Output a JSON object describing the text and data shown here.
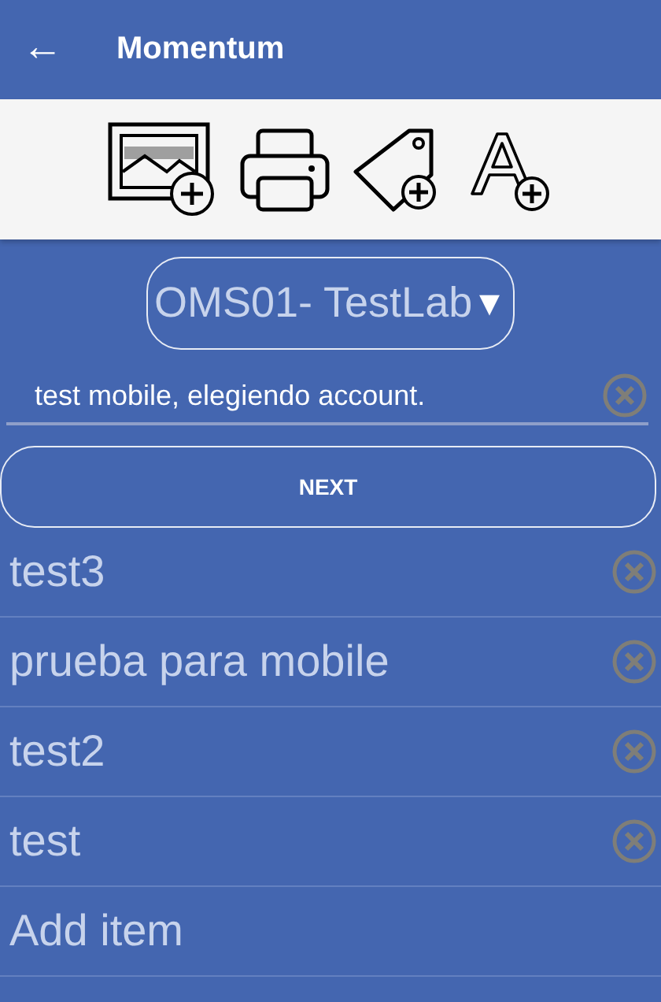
{
  "app_bar": {
    "back_icon": "←",
    "title": "Momentum"
  },
  "toolbar": {
    "tools": [
      {
        "kind": "image"
      },
      {
        "kind": "printer"
      },
      {
        "kind": "tag"
      },
      {
        "kind": "text"
      }
    ]
  },
  "account_dropdown": {
    "value": "OMS01- TestLab",
    "caret": "▼"
  },
  "text_field": {
    "value": "test mobile, elegiendo account."
  },
  "next_button": "NEXT",
  "items": [
    {
      "kind": "item",
      "label": "test3"
    },
    {
      "kind": "item",
      "label": "prueba para mobile"
    },
    {
      "kind": "item",
      "label": "test2"
    },
    {
      "kind": "item",
      "label": "test"
    },
    {
      "kind": "add",
      "label": "Add item"
    }
  ]
}
